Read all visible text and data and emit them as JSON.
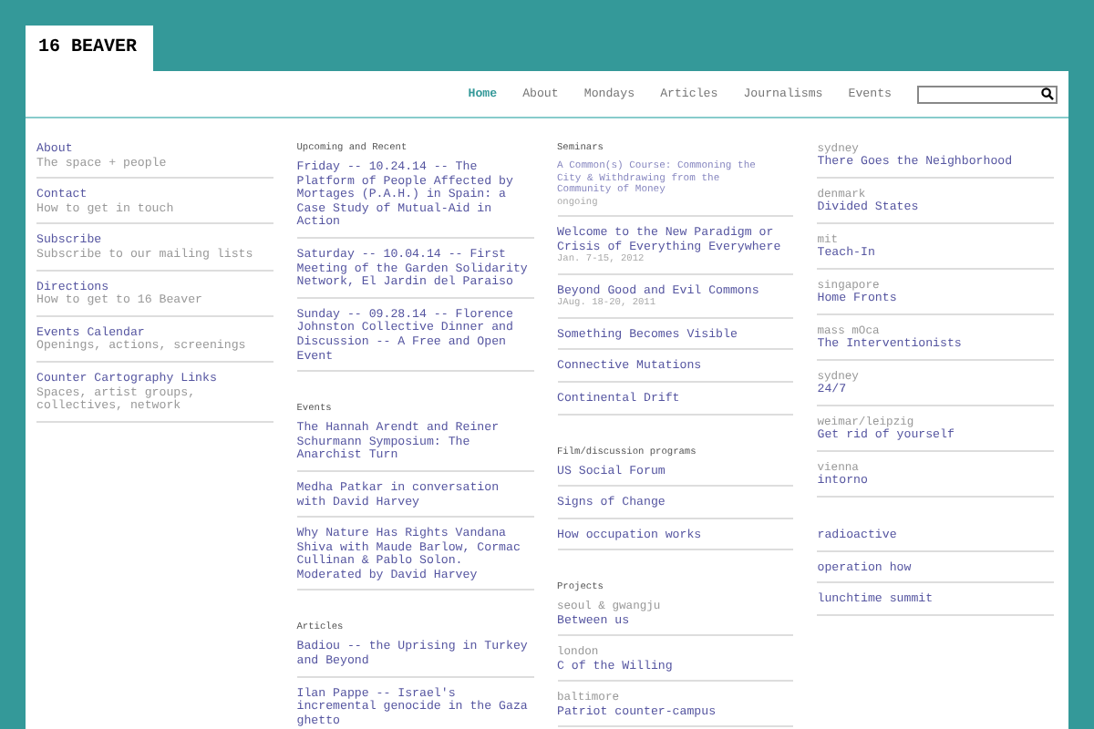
{
  "logo": "16 BEAVER",
  "nav": [
    {
      "label": "Home",
      "selected": true
    },
    {
      "label": "About",
      "selected": false
    },
    {
      "label": "Mondays",
      "selected": false
    },
    {
      "label": "Articles",
      "selected": false
    },
    {
      "label": "Journalisms",
      "selected": false
    },
    {
      "label": "Events",
      "selected": false
    }
  ],
  "columns": [
    [
      {
        "items": [
          {
            "title": "About",
            "note": "The space + people"
          },
          {
            "title": "Contact",
            "note": "How to get in touch"
          },
          {
            "title": "Subscribe",
            "note": "Subscribe to our mailing lists"
          },
          {
            "title": "Directions",
            "note": "How to get to 16 Beaver"
          },
          {
            "title": "Events Calendar",
            "note": "Openings, actions, screenings"
          },
          {
            "title": "Counter Cartography Links",
            "note": "Spaces, artist groups, collectives, network"
          }
        ]
      }
    ],
    [
      {
        "heading": "Upcoming and Recent",
        "items": [
          {
            "title": "Friday -- 10.24.14 -- The Platform of People Affected by Mortages (P.A.H.) in Spain: a Case Study of Mutual-Aid in Action"
          },
          {
            "title": "Saturday -- 10.04.14 -- First Meeting of the Garden Solidarity Network, El Jardin del Paraiso"
          },
          {
            "title": "Sunday -- 09.28.14 -- Florence Johnston Collective Dinner and Discussion -- A Free and Open Event"
          }
        ]
      },
      {
        "heading": "Events",
        "items": [
          {
            "title": "The Hannah Arendt and Reiner Schurmann Symposium: The Anarchist Turn"
          },
          {
            "title": "Medha Patkar in conversation with David Harvey"
          },
          {
            "title": "Why Nature Has Rights Vandana Shiva with Maude Barlow, Cormac Cullinan & Pablo Solon. Moderated by David Harvey"
          }
        ]
      },
      {
        "heading": "Articles",
        "items": [
          {
            "title": "Badiou -- the Uprising in Turkey and Beyond"
          },
          {
            "title": "Ilan Pappe -- Israel's incremental genocide in the Gaza ghetto"
          }
        ]
      }
    ],
    [
      {
        "heading": "Seminars",
        "items": [
          {
            "kind": "minor",
            "title": "A Common(s) Course: Commoning the City & Withdrawing from the Community of Money",
            "note": "ongoing"
          },
          {
            "kind": "link",
            "title": "Welcome to the New Paradigm or Crisis of Everything Everywhere",
            "note": "Jan. 7-15, 2012"
          },
          {
            "kind": "link",
            "title": "Beyond Good and Evil Commons",
            "note": "JAug. 18-20, 2011"
          },
          {
            "kind": "link",
            "title": "Something Becomes Visible"
          },
          {
            "kind": "link",
            "title": "Connective Mutations"
          },
          {
            "kind": "link",
            "title": "Continental Drift"
          }
        ]
      },
      {
        "heading": "Film/discussion programs",
        "items": [
          {
            "title": "US Social Forum"
          },
          {
            "title": "Signs of Change"
          },
          {
            "title": "How occupation works"
          }
        ]
      },
      {
        "heading": "Projects",
        "items": [
          {
            "label": "seoul & gwangju",
            "title": "Between us"
          },
          {
            "label": "london",
            "title": "C of the Willing"
          },
          {
            "label": "baltimore",
            "title": "Patriot counter-campus"
          }
        ]
      }
    ],
    [
      {
        "items": [
          {
            "label": "sydney",
            "title": "There Goes the Neighborhood"
          },
          {
            "label": "denmark",
            "title": "Divided States"
          },
          {
            "label": "mit",
            "title": "Teach-In"
          },
          {
            "label": "singapore",
            "title": "Home Fronts"
          },
          {
            "label": "mass mOca",
            "title": "The Interventionists"
          },
          {
            "label": "sydney",
            "title": "24/7"
          },
          {
            "label": "weimar/leipzig",
            "title": "Get rid of yourself"
          },
          {
            "label": "vienna",
            "title": "intorno"
          }
        ]
      },
      {
        "items": [
          {
            "title": "radioactive"
          },
          {
            "title": "operation how"
          },
          {
            "title": "lunchtime summit"
          }
        ]
      }
    ]
  ]
}
